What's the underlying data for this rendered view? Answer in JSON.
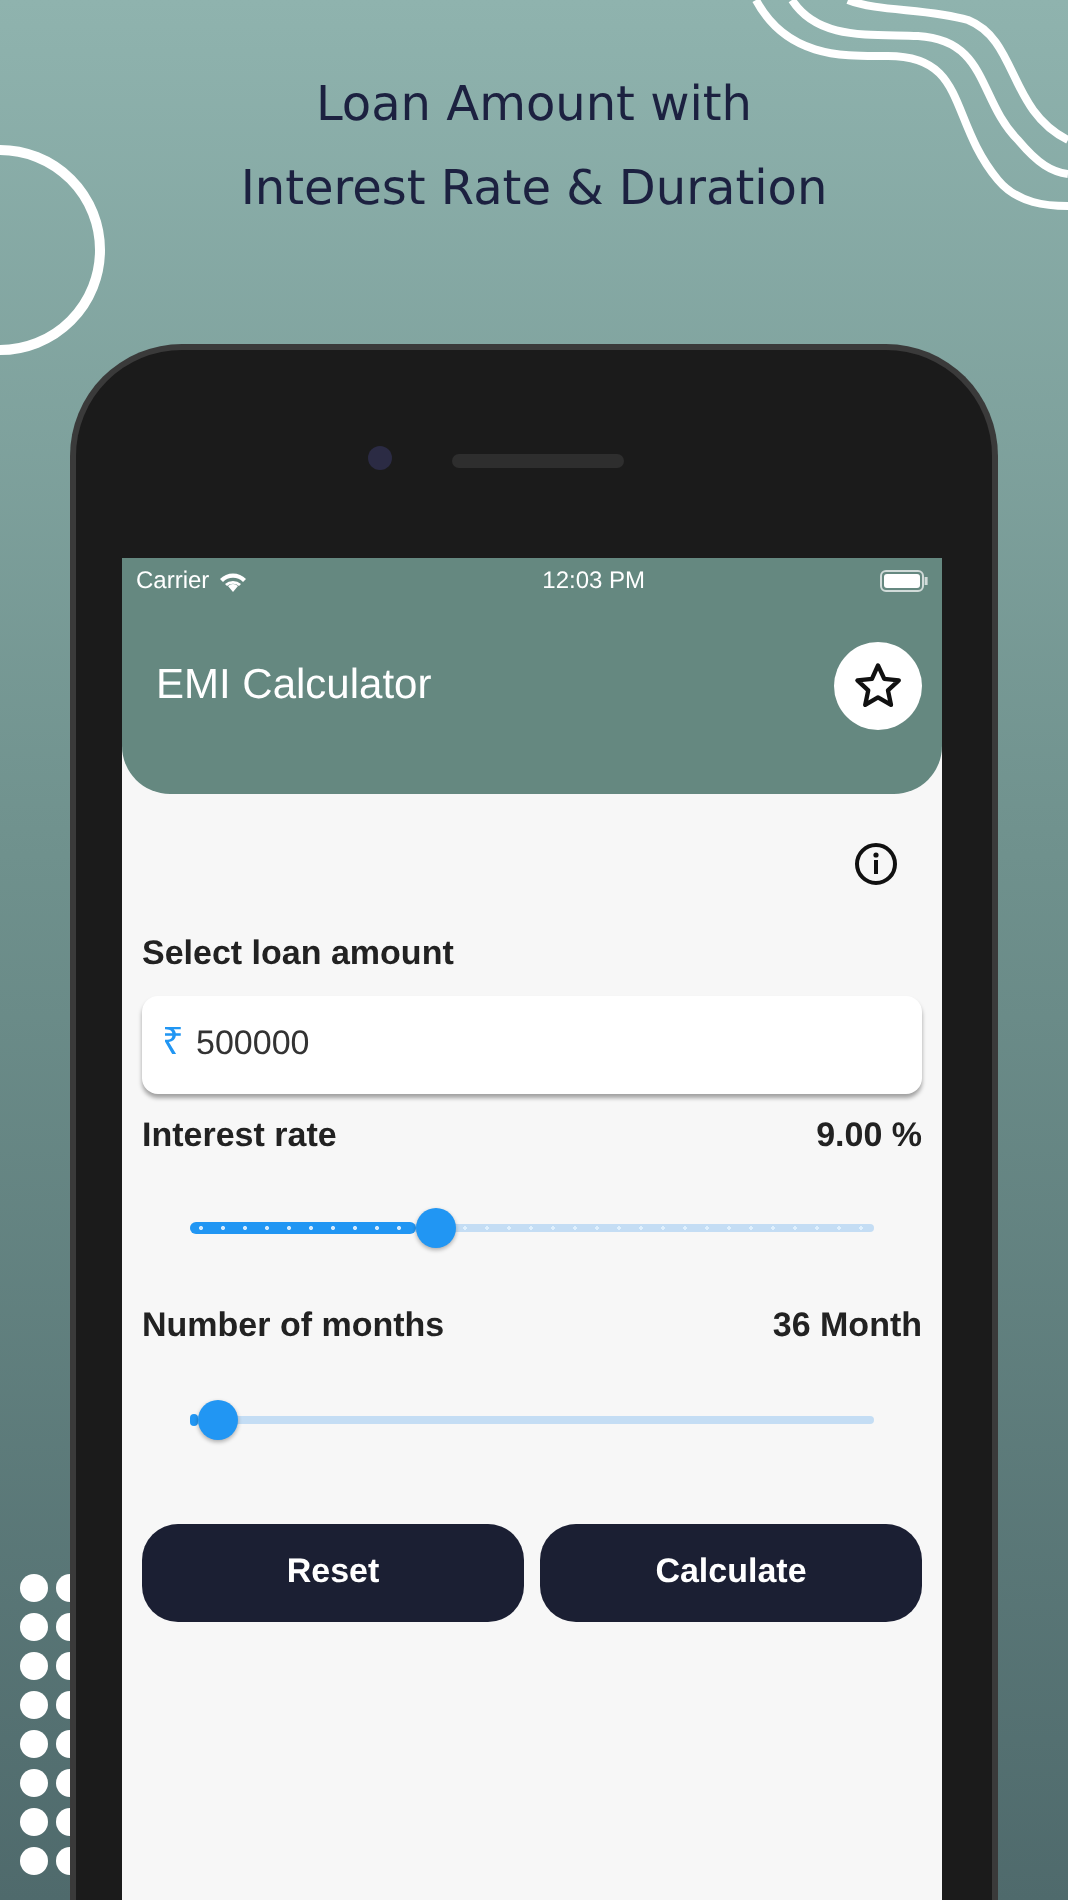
{
  "headline": "Loan Amount with\nInterest Rate & Duration",
  "status_bar": {
    "carrier": "Carrier",
    "time": "12:03 PM"
  },
  "app_bar": {
    "title": "EMI Calculator"
  },
  "loan_amount": {
    "label": "Select loan amount",
    "currency": "₹",
    "value": "500000"
  },
  "sliders": [
    {
      "kind": "discrete",
      "label": "Interest rate",
      "reading": "9.00 %",
      "level": 0.36
    },
    {
      "kind": "continuous",
      "label": "Number of months",
      "reading": "36 Month",
      "level": 0.04
    }
  ],
  "buttons": [
    "Reset",
    "Calculate"
  ]
}
